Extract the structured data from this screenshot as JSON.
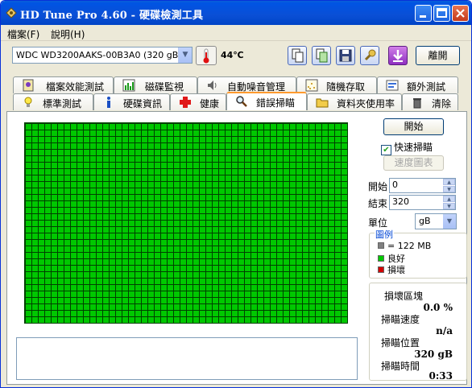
{
  "window": {
    "title": "HD Tune Pro 4.60 - 硬碟檢測工具"
  },
  "menu": {
    "file": "檔案(F)",
    "help": "說明(H)"
  },
  "toolbar": {
    "drive": "WDC WD3200AAKS-00B3A0 (320 gB)",
    "temperature": "44℃",
    "exit_label": "離開"
  },
  "tabs_row1": [
    {
      "label": "檔案效能測試",
      "icon": "file-bench-icon"
    },
    {
      "label": "磁碟監視",
      "icon": "disk-monitor-icon"
    },
    {
      "label": "自動噪音管理",
      "icon": "speaker-icon"
    },
    {
      "label": "隨機存取",
      "icon": "random-access-icon"
    },
    {
      "label": "額外測試",
      "icon": "extra-tests-icon"
    }
  ],
  "tabs_row2": [
    {
      "label": "標準測試",
      "icon": "benchmark-icon"
    },
    {
      "label": "硬碟資訊",
      "icon": "info-icon"
    },
    {
      "label": "健康",
      "icon": "health-cross-icon"
    },
    {
      "label": "錯誤掃瞄",
      "icon": "magnifier-icon",
      "active": true
    },
    {
      "label": "資料夾使用率",
      "icon": "folder-icon"
    },
    {
      "label": "清除",
      "icon": "trash-icon"
    }
  ],
  "scan": {
    "start_button": "開始",
    "quick_scan_label": "快速掃瞄",
    "quick_scan_checked": true,
    "speed_map_button": "速度圖表",
    "start_label": "開始",
    "start_value": "0",
    "end_label": "結束",
    "end_value": "320",
    "unit_label": "單位",
    "unit_value": "gB"
  },
  "legend": {
    "title": "圖例",
    "block_size": "= 122 MB",
    "good": "良好",
    "bad": "損壞",
    "colors": {
      "block": "#808080",
      "good": "#00c800",
      "bad": "#d40000"
    }
  },
  "stats": {
    "damaged_label": "損壞區塊",
    "damaged_value": "0.0 %",
    "speed_label": "掃瞄速度",
    "speed_value": "n/a",
    "position_label": "掃瞄位置",
    "position_value": "320 gB",
    "time_label": "掃瞄時間",
    "time_value": "0:33"
  }
}
